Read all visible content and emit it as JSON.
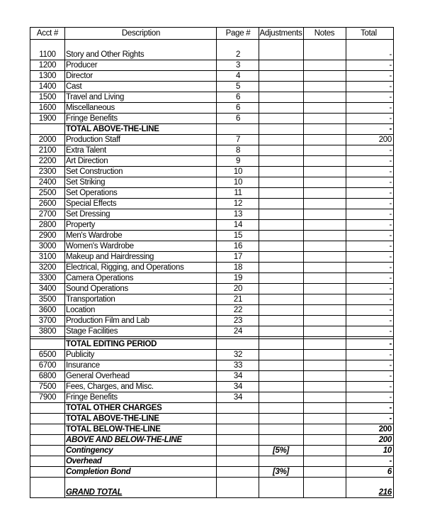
{
  "headers": {
    "acct": "Acct #",
    "description": "Description",
    "page": "Page #",
    "adjustments": "Adjustments",
    "notes": "Notes",
    "total": "Total"
  },
  "rows": [
    {
      "acct": "1100",
      "desc": "Story and Other Rights",
      "page": "2",
      "adj": "",
      "notes": "",
      "total": "-",
      "style": ""
    },
    {
      "acct": "1200",
      "desc": "Producer",
      "page": "3",
      "adj": "",
      "notes": "",
      "total": "-",
      "style": ""
    },
    {
      "acct": "1300",
      "desc": "Director",
      "page": "4",
      "adj": "",
      "notes": "",
      "total": "-",
      "style": ""
    },
    {
      "acct": "1400",
      "desc": "Cast",
      "page": "5",
      "adj": "",
      "notes": "",
      "total": "-",
      "style": ""
    },
    {
      "acct": "1500",
      "desc": "Travel and Living",
      "page": "6",
      "adj": "",
      "notes": "",
      "total": "-",
      "style": ""
    },
    {
      "acct": "1600",
      "desc": "Miscellaneous",
      "page": "6",
      "adj": "",
      "notes": "",
      "total": "-",
      "style": ""
    },
    {
      "acct": "1900",
      "desc": "Fringe Benefits",
      "page": "6",
      "adj": "",
      "notes": "",
      "total": "-",
      "style": ""
    },
    {
      "acct": "",
      "desc": "TOTAL ABOVE-THE-LINE",
      "page": "",
      "adj": "",
      "notes": "",
      "total": "-",
      "style": "bold"
    },
    {
      "acct": "2000",
      "desc": "Production Staff",
      "page": "7",
      "adj": "",
      "notes": "",
      "total": "200",
      "style": ""
    },
    {
      "acct": "2100",
      "desc": "Extra Talent",
      "page": "8",
      "adj": "",
      "notes": "",
      "total": "-",
      "style": ""
    },
    {
      "acct": "2200",
      "desc": "Art Direction",
      "page": "9",
      "adj": "",
      "notes": "",
      "total": "-",
      "style": ""
    },
    {
      "acct": "2300",
      "desc": "Set Construction",
      "page": "10",
      "adj": "",
      "notes": "",
      "total": "-",
      "style": ""
    },
    {
      "acct": "2400",
      "desc": "Set Striking",
      "page": "10",
      "adj": "",
      "notes": "",
      "total": "-",
      "style": ""
    },
    {
      "acct": "2500",
      "desc": "Set Operations",
      "page": "11",
      "adj": "",
      "notes": "",
      "total": "-",
      "style": ""
    },
    {
      "acct": "2600",
      "desc": "Special Effects",
      "page": "12",
      "adj": "",
      "notes": "",
      "total": "-",
      "style": ""
    },
    {
      "acct": "2700",
      "desc": "Set Dressing",
      "page": "13",
      "adj": "",
      "notes": "",
      "total": "-",
      "style": ""
    },
    {
      "acct": "2800",
      "desc": "Property",
      "page": "14",
      "adj": "",
      "notes": "",
      "total": "-",
      "style": ""
    },
    {
      "acct": "2900",
      "desc": "Men's Wardrobe",
      "page": "15",
      "adj": "",
      "notes": "",
      "total": "-",
      "style": ""
    },
    {
      "acct": "3000",
      "desc": "Women's Wardrobe",
      "page": "16",
      "adj": "",
      "notes": "",
      "total": "-",
      "style": ""
    },
    {
      "acct": "3100",
      "desc": "Makeup and Hairdressing",
      "page": "17",
      "adj": "",
      "notes": "",
      "total": "-",
      "style": ""
    },
    {
      "acct": "3200",
      "desc": "Electrical, Rigging, and Operations",
      "page": "18",
      "adj": "",
      "notes": "",
      "total": "-",
      "style": ""
    },
    {
      "acct": "3300",
      "desc": "Camera Operations",
      "page": "19",
      "adj": "",
      "notes": "",
      "total": "-",
      "style": ""
    },
    {
      "acct": "3400",
      "desc": "Sound Operations",
      "page": "20",
      "adj": "",
      "notes": "",
      "total": "-",
      "style": ""
    },
    {
      "acct": "3500",
      "desc": "Transportation",
      "page": "21",
      "adj": "",
      "notes": "",
      "total": "-",
      "style": ""
    },
    {
      "acct": "3600",
      "desc": "Location",
      "page": "22",
      "adj": "",
      "notes": "",
      "total": "-",
      "style": ""
    },
    {
      "acct": "3700",
      "desc": "Production Film and Lab",
      "page": "23",
      "adj": "",
      "notes": "",
      "total": "-",
      "style": ""
    },
    {
      "acct": "3800",
      "desc": "Stage Facilities",
      "page": "24",
      "adj": "",
      "notes": "",
      "total": "-",
      "style": ""
    }
  ],
  "rows2": [
    {
      "acct": "",
      "desc": "TOTAL EDITING PERIOD",
      "page": "",
      "adj": "",
      "notes": "",
      "total": "-",
      "style": "bold"
    },
    {
      "acct": "6500",
      "desc": "Publicity",
      "page": "32",
      "adj": "",
      "notes": "",
      "total": "-",
      "style": ""
    },
    {
      "acct": "6700",
      "desc": "Insurance",
      "page": "33",
      "adj": "",
      "notes": "",
      "total": "-",
      "style": ""
    },
    {
      "acct": "6800",
      "desc": "General Overhead",
      "page": "34",
      "adj": "",
      "notes": "",
      "total": "-",
      "style": ""
    },
    {
      "acct": "7500",
      "desc": "Fees, Charges, and Misc.",
      "page": "34",
      "adj": "",
      "notes": "",
      "total": "-",
      "style": ""
    },
    {
      "acct": "7900",
      "desc": "Fringe Benefits",
      "page": "34",
      "adj": "",
      "notes": "",
      "total": "-",
      "style": ""
    },
    {
      "acct": "",
      "desc": "TOTAL OTHER CHARGES",
      "page": "",
      "adj": "",
      "notes": "",
      "total": "-",
      "style": "bold"
    },
    {
      "acct": "",
      "desc": "TOTAL ABOVE-THE-LINE",
      "page": "",
      "adj": "",
      "notes": "",
      "total": "-",
      "style": "bold"
    },
    {
      "acct": "",
      "desc": "TOTAL BELOW-THE-LINE",
      "page": "",
      "adj": "",
      "notes": "",
      "total": "200",
      "style": "bold"
    },
    {
      "acct": "",
      "desc": "ABOVE AND BELOW-THE-LINE",
      "page": "",
      "adj": "",
      "notes": "",
      "total": "200",
      "style": "bi"
    },
    {
      "acct": "",
      "desc": "Contingency",
      "page": "",
      "adj": "[5%]",
      "notes": "",
      "total": "10",
      "style": "bi"
    },
    {
      "acct": "",
      "desc": "Overhead",
      "page": "",
      "adj": "",
      "notes": "",
      "total": "-",
      "style": "bi"
    },
    {
      "acct": "",
      "desc": "Completion Bond",
      "page": "",
      "adj": "[3%]",
      "notes": "",
      "total": "6",
      "style": "bi"
    }
  ],
  "grand_total": {
    "desc": "GRAND TOTAL",
    "total": "216"
  }
}
